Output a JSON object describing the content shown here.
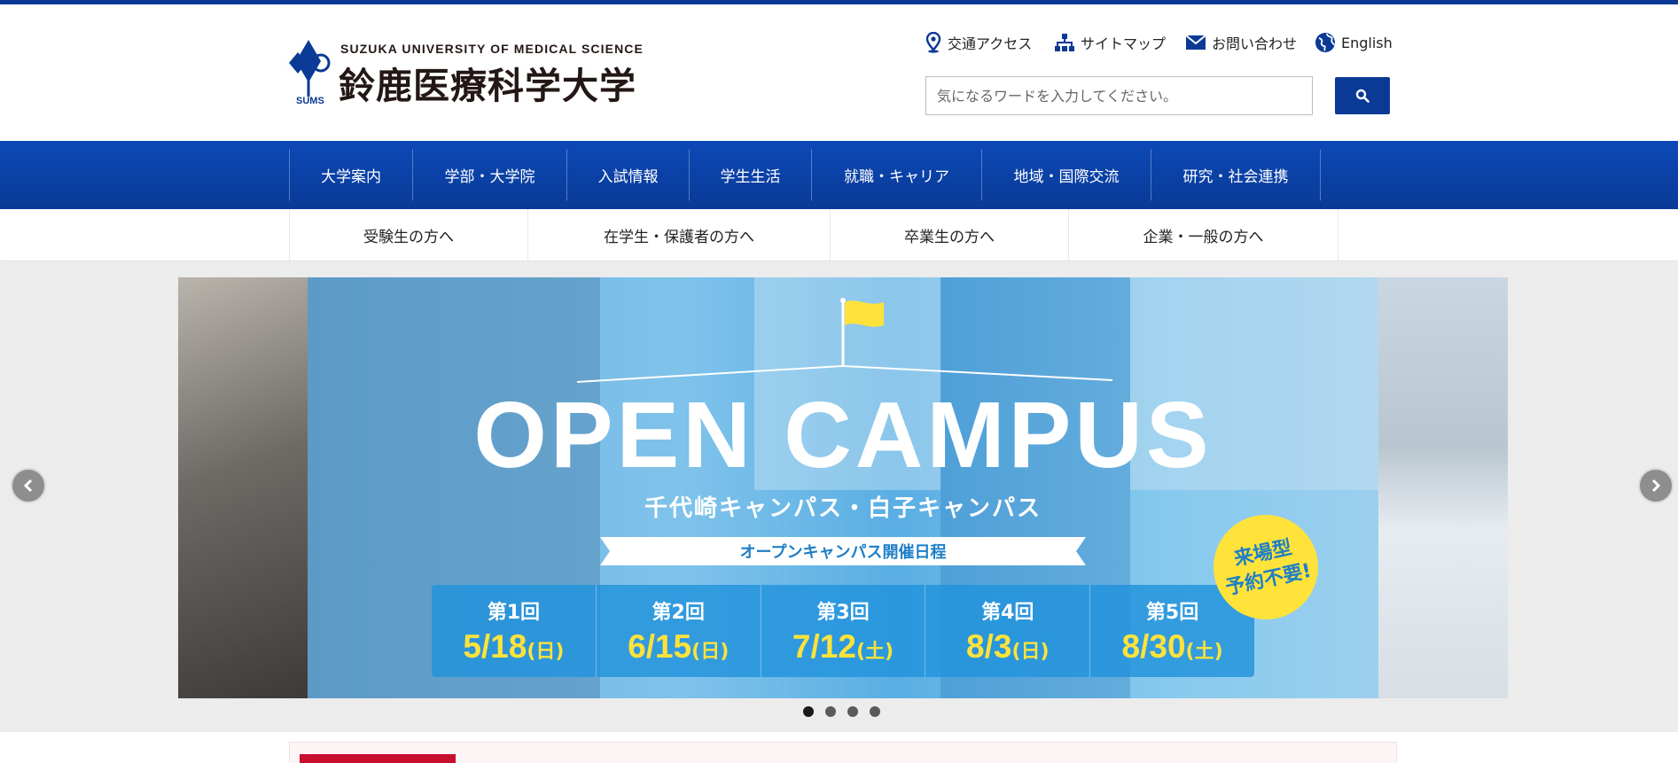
{
  "colors": {
    "brand": "#0a3a96",
    "nav_top": "#0c49b7",
    "accent_yellow": "#ffe33b",
    "news_red": "#c8102e"
  },
  "logo": {
    "en": "SUZUKA UNIVERSITY OF MEDICAL SCIENCE",
    "ja": "鈴鹿医療科学大学",
    "abbr": "SUMS"
  },
  "utility": [
    {
      "label": "交通アクセス",
      "icon": "map-pin-icon"
    },
    {
      "label": "サイトマップ",
      "icon": "sitemap-icon"
    },
    {
      "label": "お問い合わせ",
      "icon": "mail-icon"
    },
    {
      "label": "English",
      "icon": "globe-icon"
    }
  ],
  "search": {
    "placeholder": "気になるワードを入力してください。",
    "button_icon": "search-icon"
  },
  "global_nav": [
    "大学案内",
    "学部・大学院",
    "入試情報",
    "学生生活",
    "就職・キャリア",
    "地域・国際交流",
    "研究・社会連携"
  ],
  "audience_nav": [
    "受験生の方へ",
    "在学生・保護者の方へ",
    "卒業生の方へ",
    "企業・一般の方へ"
  ],
  "slide": {
    "title": "OPEN CAMPUS",
    "subtitle": "千代崎キャンパス・白子キャンパス",
    "ribbon": "オープンキャンパス開催日程",
    "badge_line1": "来場型",
    "badge_line2": "予約不要!",
    "dates": [
      {
        "round": "第1回",
        "date": "5/18",
        "day": "(日)"
      },
      {
        "round": "第2回",
        "date": "6/15",
        "day": "(日)"
      },
      {
        "round": "第3回",
        "date": "7/12",
        "day": "(土)"
      },
      {
        "round": "第4回",
        "date": "8/3",
        "day": "(日)"
      },
      {
        "round": "第5回",
        "date": "8/30",
        "day": "(土)"
      }
    ]
  },
  "carousel": {
    "slide_count": 4,
    "active_index": 0
  }
}
